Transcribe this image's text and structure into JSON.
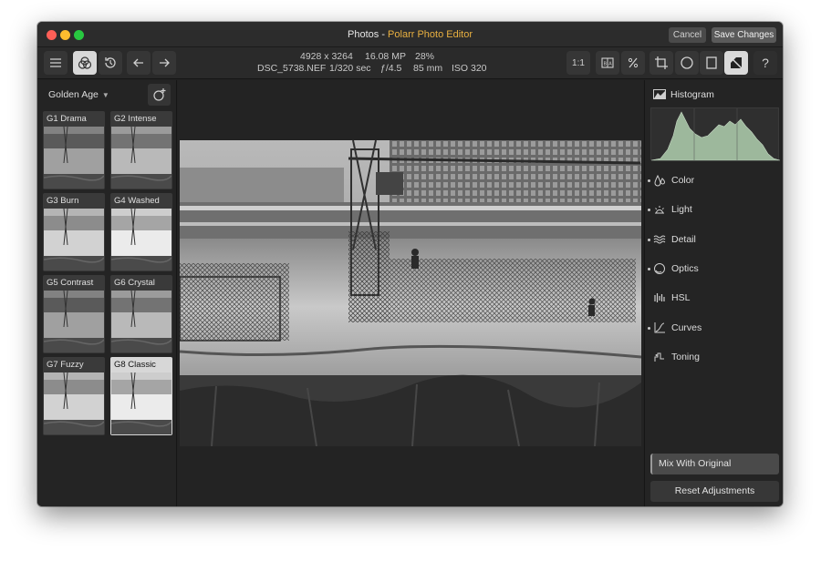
{
  "window": {
    "title_prefix": "Photos - ",
    "app_name": "Polarr Photo Editor",
    "cancel_label": "Cancel",
    "save_label": "Save Changes"
  },
  "toolbar": {
    "left_tools": [
      "menu-icon",
      "filters-icon",
      "history-icon",
      "undo-icon",
      "redo-icon"
    ],
    "meta": {
      "dimensions": "4928 x 3264",
      "megapixels": "16.08 MP",
      "zoom": "28%",
      "filename": "DSC_5738.NEF",
      "shutter": "1/320 sec",
      "aperture": "ƒ/4.5",
      "focal_length": "85 mm",
      "iso": "ISO 320"
    },
    "zoom_label": "1:1",
    "right_tools": [
      "before-after-icon",
      "percent-icon",
      "crop-icon",
      "circle-mask-icon",
      "square-mask-icon",
      "local-adjust-icon",
      "help-icon"
    ],
    "help_label": "?"
  },
  "presets": {
    "group": "Golden Age",
    "items": [
      {
        "label": "G1 Drama",
        "selected": false
      },
      {
        "label": "G2 Intense",
        "selected": false
      },
      {
        "label": "G3 Burn",
        "selected": false
      },
      {
        "label": "G4 Washed",
        "selected": false
      },
      {
        "label": "G5 Contrast",
        "selected": false
      },
      {
        "label": "G6 Crystal",
        "selected": false
      },
      {
        "label": "G7 Fuzzy",
        "selected": false
      },
      {
        "label": "G8 Classic",
        "selected": true
      }
    ]
  },
  "right_panel": {
    "histogram_label": "Histogram",
    "histogram_color": "#9db89c",
    "adjustments": [
      {
        "label": "Color",
        "icon": "color-drops-icon",
        "dot": true
      },
      {
        "label": "Light",
        "icon": "light-sun-icon",
        "dot": true
      },
      {
        "label": "Detail",
        "icon": "detail-waves-icon",
        "dot": true
      },
      {
        "label": "Optics",
        "icon": "optics-lens-icon",
        "dot": true
      },
      {
        "label": "HSL",
        "icon": "hsl-bars-icon",
        "dot": false
      },
      {
        "label": "Curves",
        "icon": "curves-icon",
        "dot": true
      },
      {
        "label": "Toning",
        "icon": "toning-icon",
        "dot": false
      }
    ],
    "mix_label": "Mix With Original",
    "reset_label": "Reset Adjustments"
  },
  "colors": {
    "accent": "#e9b040",
    "panel": "#242424",
    "active_tool": "#d9d9d9"
  }
}
